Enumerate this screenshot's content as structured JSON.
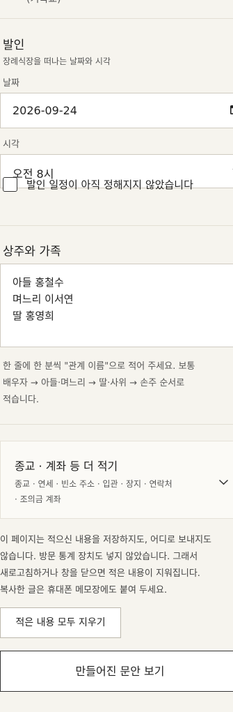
{
  "top_fragment": "(기독교)",
  "departure": {
    "title": "발인",
    "hint": "장례식장을 떠나는 날짜와 시각",
    "date_label": "날짜",
    "date_value": "2026-09-24",
    "time_label": "시각",
    "time_value": "오전 8시",
    "undecided_label": "발인 일정이 아직 정해지지 않았습니다",
    "undecided_checked": false
  },
  "mourners": {
    "title": "상주와 가족",
    "lines": [
      "아들 홍철수",
      "며느리 이서연",
      "딸 홍영희"
    ],
    "help_line1": "한 줄에 한 분씩 \"관계 이름\"으로 적어 주세요. 보통",
    "help_line2": "배우자 → 아들·며느리 → 딸·사위 → 손주 순서로",
    "help_line3": "적습니다."
  },
  "more": {
    "title": "종교 · 계좌 등 더 적기",
    "summary_line1": "종교 · 연세 · 빈소 주소 · 입관 · 장지 · 연락처",
    "summary_line2": "· 조의금 계좌"
  },
  "notice": {
    "line1": "이 페이지는 적으신 내용을 저장하지도, 어디로 보내지도",
    "line2": "않습니다. 방문 통계 장치도 넣지 않았습니다. 그래서",
    "line3": "새로고침하거나 창을 닫으면 적은 내용이 지워집니다.",
    "line4": "복사한 글은 휴대폰 메모장에도 붙여 두세요."
  },
  "buttons": {
    "clear_label": "적은 내용 모두 지우기",
    "preview_label": "만들어진 문안 보기"
  },
  "colors": {
    "page_bg": "#f6f4ee",
    "field_bg": "#ffffff",
    "border": "#cfcac0"
  }
}
